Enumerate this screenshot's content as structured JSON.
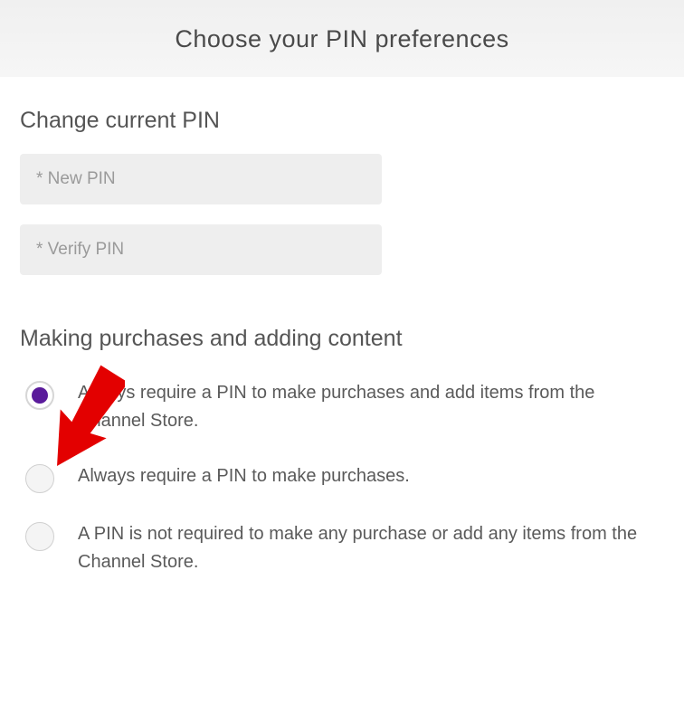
{
  "header": {
    "title": "Choose your PIN preferences"
  },
  "change_pin": {
    "title": "Change current PIN",
    "new_pin_placeholder": "* New PIN",
    "verify_pin_placeholder": "* Verify PIN"
  },
  "purchases": {
    "title": "Making purchases and adding content",
    "options": [
      "Always require a PIN to make purchases and add items from the Channel Store.",
      "Always require a PIN to make purchases.",
      "A PIN is not required to make any purchase or add any items from the Channel Store."
    ],
    "selected_index": 0
  }
}
